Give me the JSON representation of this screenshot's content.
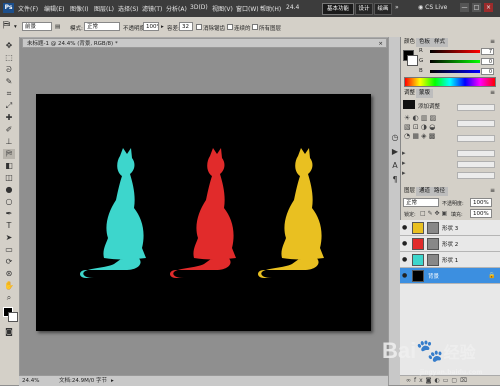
{
  "app": {
    "logo": "Ps",
    "menu": [
      "文件(F)",
      "编辑(E)",
      "图像(I)",
      "图层(L)",
      "选择(S)",
      "滤镜(T)",
      "分析(A)",
      "3D(D)",
      "视图(V)",
      "窗口(W)",
      "帮助(H)"
    ],
    "zoom_display": "24.4",
    "workspace_buttons": [
      "基本功能",
      "设计",
      "绘画"
    ],
    "cs_live": "CS Live",
    "window_controls": [
      "—",
      "□",
      "×"
    ]
  },
  "options_bar": {
    "tool_preset": "前景",
    "mode_label": "模式:",
    "mode_value": "正常",
    "opacity_label": "不透明度:",
    "opacity_value": "100%",
    "tolerance_label": "容差:",
    "tolerance_value": "32",
    "antialias_label": "消除锯齿",
    "contiguous_label": "连续的",
    "all_layers_label": "所有图层"
  },
  "document": {
    "tab_title": "未标题-1 @ 24.4% (背景, RGB/8) *",
    "status_zoom": "24.4%",
    "status_doc": "文档:24.9M/0 字节"
  },
  "canvas": {
    "background": "#000000",
    "cat_colors": [
      "#3dd6cc",
      "#e12b2b",
      "#e9c021"
    ]
  },
  "panels": {
    "color_tabs": [
      "颜色",
      "色板",
      "样式"
    ],
    "color_values": {
      "r": "7",
      "g": "0",
      "b": "0"
    },
    "adjust_tabs": [
      "调整",
      "蒙版"
    ],
    "adjust_title": "添加调整",
    "layers_tabs": [
      "图层",
      "通道",
      "路径"
    ],
    "blend_mode": "正常",
    "opacity_label": "不透明度:",
    "opacity_value": "100%",
    "lock_label": "锁定:",
    "fill_label": "填充:",
    "fill_value": "100%",
    "layers": [
      {
        "name": "形状 3",
        "color": "#e9c021",
        "selected": false
      },
      {
        "name": "形状 2",
        "color": "#e12b2b",
        "selected": false
      },
      {
        "name": "形状 1",
        "color": "#3dd6cc",
        "selected": false
      },
      {
        "name": "背景",
        "color": "#000000",
        "selected": true
      }
    ],
    "lock_icon_text": "🔒",
    "footer_icons": [
      "link-icon",
      "fx-icon",
      "mask-icon",
      "adjustment-icon",
      "folder-icon",
      "new-layer-icon",
      "trash-icon"
    ]
  },
  "watermark": {
    "brand": "Bai",
    "brand_suffix": "经验",
    "url": "jingyan.baidu.com"
  }
}
